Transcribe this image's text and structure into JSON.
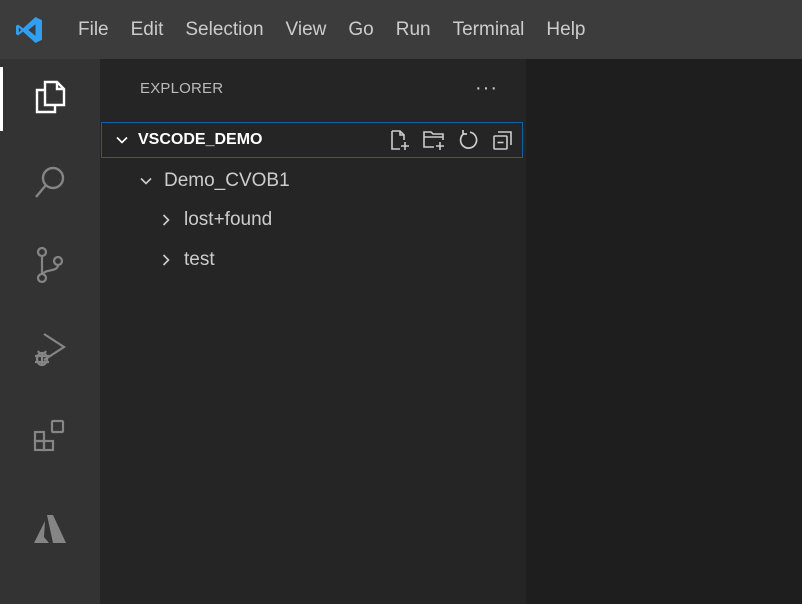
{
  "titlebar": {
    "app_logo_icon": "vscode-logo-icon",
    "menu": [
      "File",
      "Edit",
      "Selection",
      "View",
      "Go",
      "Run",
      "Terminal",
      "Help"
    ]
  },
  "activity_bar": {
    "items": [
      {
        "icon": "files-icon",
        "active": true
      },
      {
        "icon": "search-icon",
        "active": false
      },
      {
        "icon": "source-control-icon",
        "active": false
      },
      {
        "icon": "run-debug-icon",
        "active": false
      },
      {
        "icon": "extensions-icon",
        "active": false
      },
      {
        "icon": "azure-icon",
        "active": false
      }
    ]
  },
  "explorer": {
    "title": "EXPLORER",
    "more_label": "···",
    "root": {
      "label": "VSCODE_DEMO",
      "actions": [
        "new-file-icon",
        "new-folder-icon",
        "refresh-icon",
        "collapse-all-icon"
      ]
    },
    "tree": [
      {
        "label": "Demo_CVOB1",
        "expanded": true,
        "depth": 1
      },
      {
        "label": "lost+found",
        "expanded": false,
        "depth": 2
      },
      {
        "label": "test",
        "expanded": false,
        "depth": 2
      }
    ]
  },
  "colors": {
    "titlebar_bg": "#3c3c3c",
    "activitybar_bg": "#333333",
    "sidebar_bg": "#252526",
    "editor_bg": "#1e1e1e",
    "focus_border": "#0e639c",
    "vscode_blue": "#2f9ff3"
  }
}
